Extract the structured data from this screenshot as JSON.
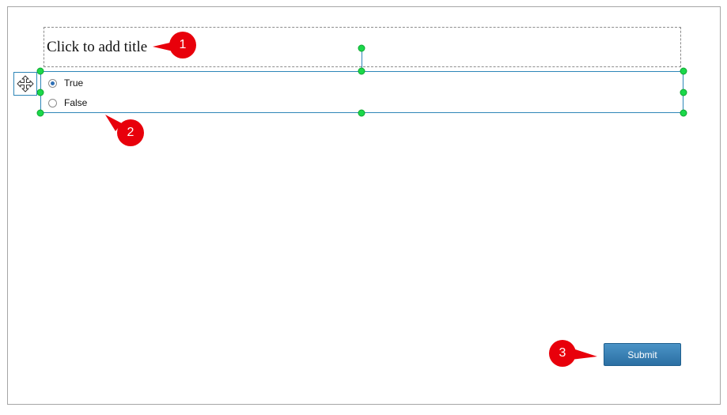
{
  "slide": {
    "title_placeholder": "Click to add title",
    "options": [
      {
        "label": "True",
        "selected": true
      },
      {
        "label": "False",
        "selected": false
      }
    ],
    "submit_label": "Submit"
  },
  "callouts": [
    "1",
    "2",
    "3"
  ],
  "colors": {
    "selection": "#2e86b8",
    "handle": "#1bd84a",
    "callout": "#e8000b",
    "button": "#3a81b6"
  },
  "icons": {
    "move": "move-arrows-icon",
    "radio_checked": "radio-checked-icon",
    "radio_unchecked": "radio-unchecked-icon"
  }
}
